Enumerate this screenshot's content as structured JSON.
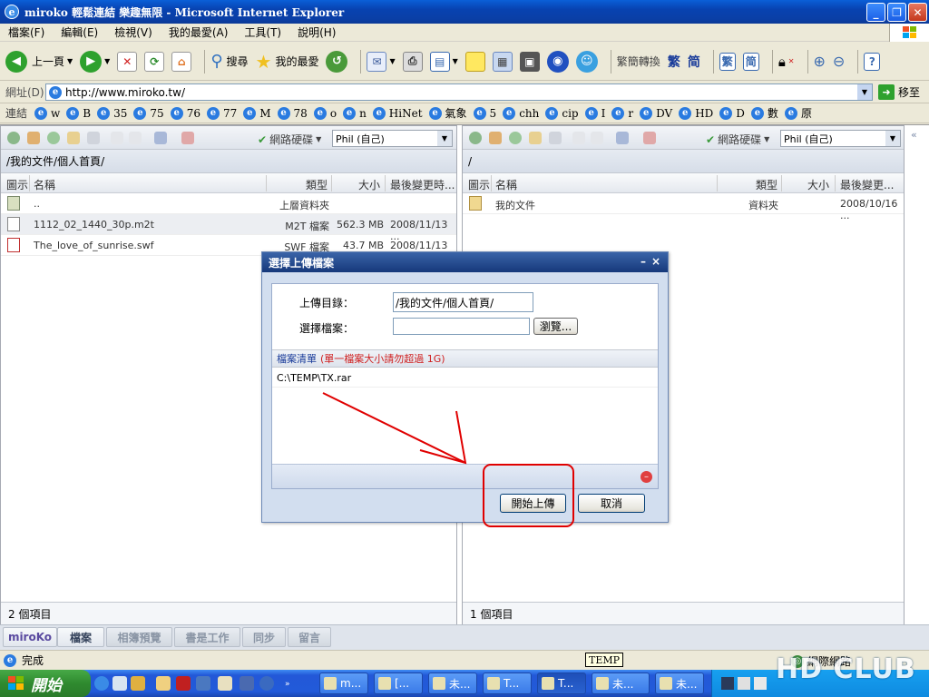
{
  "window": {
    "title": "miroko 輕鬆連結 樂趣無限 - Microsoft Internet Explorer",
    "icon": "ie-icon"
  },
  "menu": [
    "檔案(F)",
    "編輯(E)",
    "檢視(V)",
    "我的最愛(A)",
    "工具(T)",
    "說明(H)"
  ],
  "toolbar": {
    "back_label": "上一頁",
    "search_label": "搜尋",
    "favorites_label": "我的最愛",
    "convert_label": "繁簡轉換",
    "trad_label": "繁",
    "simp_label": "简"
  },
  "address": {
    "label": "網址(D)",
    "url": "http://www.miroko.tw/",
    "go_label": "移至"
  },
  "links": {
    "label": "連結",
    "items": [
      "w",
      "B",
      "35",
      "75",
      "76",
      "77",
      "M",
      "78",
      "o",
      "n",
      "HiNet",
      "氣象",
      "5",
      "chh",
      "cip",
      "I",
      "r",
      "DV",
      "HD",
      "D",
      "數",
      "原"
    ]
  },
  "left_pane": {
    "disk_label": "網路硬碟",
    "user_select": "Phil (自己)",
    "path": "/我的文件/個人首頁/",
    "columns": {
      "icon": "圖示",
      "name": "名稱",
      "type": "類型",
      "size": "大小",
      "modified": "最後變更時..."
    },
    "rows": [
      {
        "name": "..",
        "type": "上層資料夾",
        "size": "",
        "modified": ""
      },
      {
        "name": "1112_02_1440_30p.m2t",
        "type": "M2T 檔案",
        "size": "562.3 MB",
        "modified": "2008/11/13 ..."
      },
      {
        "name": "The_love_of_sunrise.swf",
        "type": "SWF 檔案",
        "size": "43.7 MB",
        "modified": "2008/11/13 ..."
      }
    ],
    "status": "2 個項目"
  },
  "right_pane": {
    "disk_label": "網路硬碟",
    "user_select": "Phil (自己)",
    "path": "/",
    "columns": {
      "icon": "圖示",
      "name": "名稱",
      "type": "類型",
      "size": "大小",
      "modified": "最後變更..."
    },
    "rows": [
      {
        "name": "我的文件",
        "type": "資料夾",
        "size": "",
        "modified": "2008/10/16 ..."
      }
    ],
    "status": "1 個項目"
  },
  "tabs": [
    "miroKo",
    "檔案",
    "相簿預覽",
    "書是工作",
    "同步",
    "留言"
  ],
  "dialog": {
    "title": "選擇上傳檔案",
    "upload_dir_label": "上傳目錄：",
    "upload_dir_value": "/我的文件/個人首頁/",
    "choose_file_label": "選擇檔案：",
    "choose_file_value": "",
    "browse_label": "瀏覽...",
    "file_list_label": "檔案清單",
    "file_list_note": "(單一檔案大小請勿超過 1G)",
    "files": [
      "C:\\TEMP\\TX.rar"
    ],
    "start_label": "開始上傳",
    "cancel_label": "取消"
  },
  "status": {
    "text": "完成",
    "temp_tooltip": "TEMP",
    "zone": "網際網路"
  },
  "taskbar": {
    "start_label": "開始",
    "tasks": [
      "m...",
      "[...",
      "未...",
      "T...",
      "T...",
      "未...",
      "未..."
    ]
  },
  "colors": {
    "annotation": "#e00000",
    "title_blue": "#0a3fa6",
    "dialog_title": "#16387a"
  }
}
